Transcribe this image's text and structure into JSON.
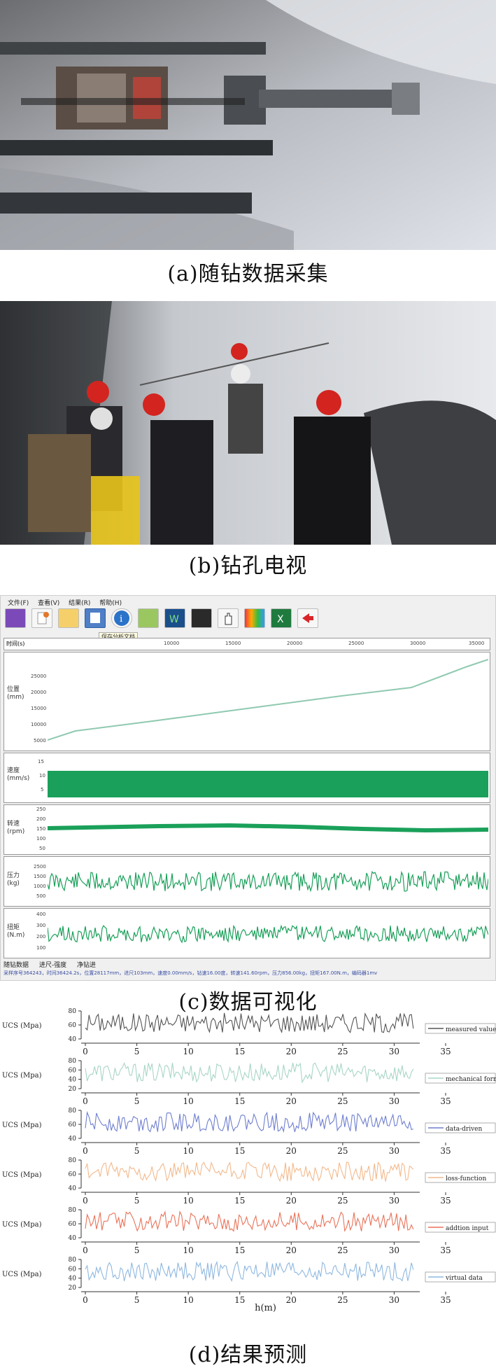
{
  "captions": {
    "a": "(a)随钻数据采集",
    "b": "(b)钻孔电视",
    "c": "(c)数据可视化",
    "d": "(d)结果预测"
  },
  "software": {
    "menus": [
      "文件(F)",
      "查看(V)",
      "结果(R)",
      "帮助(H)"
    ],
    "tooltip": "保存分析文档",
    "time_axis": {
      "label": "时间(s)",
      "ticks": [
        "10000",
        "15000",
        "20000",
        "25000",
        "30000",
        "35000"
      ]
    },
    "panels": [
      {
        "label": "位置\n(mm)",
        "ticks": [
          "25000",
          "20000",
          "15000",
          "10000",
          "5000"
        ]
      },
      {
        "label": "速度\n(mm/s)",
        "ticks": [
          "15",
          "10",
          "5"
        ]
      },
      {
        "label": "转速\n(rpm)",
        "ticks": [
          "250",
          "200",
          "150",
          "100",
          "50"
        ]
      },
      {
        "label": "压力\n(kg)",
        "ticks": [
          "2500",
          "1500",
          "1000",
          "500"
        ]
      },
      {
        "label": "扭矩\n(N.m)",
        "ticks": [
          "400",
          "300",
          "200",
          "100"
        ]
      }
    ],
    "tabs": [
      "随钻数据",
      "进尺-强度",
      "净钻进"
    ],
    "status_line": "采样序号364243，时间36424.2s，位置28117mm，进尺103mm，速度0.00mm/s，钻速16.00度，转速141.60rpm，压力856.00kg，扭矩167.00N.m，编码器1mv",
    "colors": {
      "plot_line": "#1aa05a",
      "position_line": "#8fc9b0"
    }
  },
  "chart_data": {
    "type": "line",
    "xlabel": "h(m)",
    "ylabel": "UCS (Mpa)",
    "xlim": [
      0,
      35
    ],
    "x_ticks": [
      "0",
      "5",
      "10",
      "15",
      "20",
      "25",
      "30",
      "35"
    ],
    "panels": [
      {
        "name": "measured value",
        "color": "#555555",
        "yticks": [
          "80",
          "60",
          "40"
        ],
        "ylim": [
          40,
          80
        ]
      },
      {
        "name": "mechanical formula",
        "color": "#a8d5c8",
        "yticks": [
          "80",
          "60",
          "40",
          "20"
        ],
        "ylim": [
          20,
          80
        ]
      },
      {
        "name": "data-driven",
        "color": "#6f7fcf",
        "yticks": [
          "80",
          "60",
          "40"
        ],
        "ylim": [
          40,
          80
        ]
      },
      {
        "name": "loss-function",
        "color": "#f2b98c",
        "yticks": [
          "80",
          "60",
          "40"
        ],
        "ylim": [
          40,
          80
        ]
      },
      {
        "name": "addtion input",
        "color": "#e8735a",
        "yticks": [
          "80",
          "60",
          "40"
        ],
        "ylim": [
          40,
          80
        ]
      },
      {
        "name": "virtual data",
        "color": "#8fb8e0",
        "yticks": [
          "80",
          "60",
          "40",
          "20"
        ],
        "ylim": [
          20,
          80
        ]
      }
    ]
  }
}
